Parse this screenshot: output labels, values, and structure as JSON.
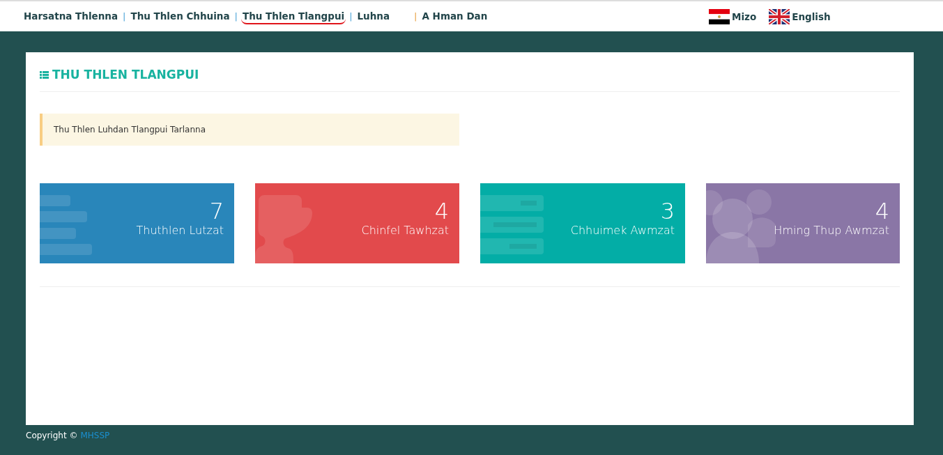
{
  "nav": {
    "items": [
      {
        "label": "Harsatna Thlenna",
        "selected": false
      },
      {
        "label": "Thu Thlen Chhuina",
        "separator": "|",
        "selected": false
      },
      {
        "label": "Thu Thlen Tlangpui",
        "separator": "|",
        "selected": true
      },
      {
        "label": "Luhna",
        "separator": "|",
        "selected": false
      },
      {
        "label": "A Hman Dan",
        "separator": "|",
        "selected": false
      }
    ],
    "languages": [
      {
        "label": "Mizo",
        "kind": "egypt"
      },
      {
        "label": "English",
        "kind": "uk"
      }
    ]
  },
  "page": {
    "title": "THU THLEN TLANGPUI",
    "alert": "Thu Thlen Luhdan Tlangpui Tarlanna",
    "tiles": [
      {
        "value": "7",
        "label": "Thuthlen Lutzat",
        "kind": "bars",
        "color": "#2986ba"
      },
      {
        "value": "4",
        "label": "Chinfel Tawhzat",
        "kind": "trophy",
        "color": "#e24a4c"
      },
      {
        "value": "3",
        "label": "Chhuimek Awmzat",
        "kind": "server",
        "color": "#03ada6"
      },
      {
        "value": "4",
        "label": "Hming Thup Awmzat",
        "kind": "users",
        "color": "#8a76a6"
      }
    ]
  },
  "footer": {
    "text": "Copyright ©",
    "link": "MHSSP"
  }
}
